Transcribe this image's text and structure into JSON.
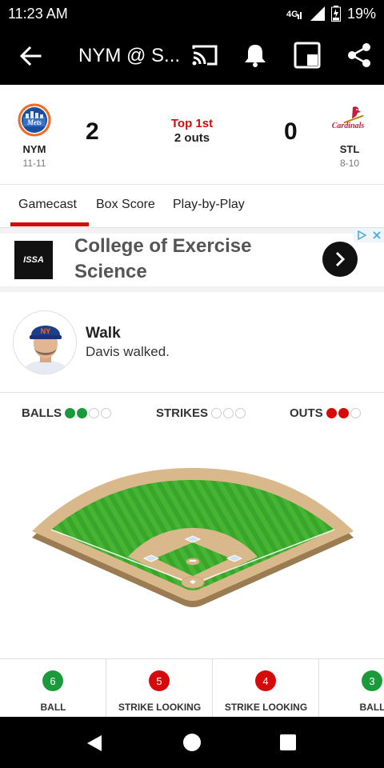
{
  "status_bar": {
    "time": "11:23 AM",
    "battery": "19%"
  },
  "app_bar": {
    "title": "NYM @ S..."
  },
  "game": {
    "away": {
      "abbr": "NYM",
      "record": "11-11",
      "score": "2"
    },
    "home": {
      "abbr": "STL",
      "record": "8-10",
      "score": "0"
    },
    "inning": "Top 1st",
    "outs_text": "2 outs"
  },
  "tabs": [
    {
      "label": "Gamecast"
    },
    {
      "label": "Box Score"
    },
    {
      "label": "Play-by-Play"
    }
  ],
  "ad": {
    "logo_text": "ISSA",
    "line1": "College of Exercise",
    "line2": "Science"
  },
  "play": {
    "title": "Walk",
    "description": "Davis walked."
  },
  "count": {
    "balls_label": "BALLS",
    "balls": 2,
    "balls_max": 4,
    "strikes_label": "STRIKES",
    "strikes": 0,
    "strikes_max": 3,
    "outs_label": "OUTS",
    "outs": 2,
    "outs_max": 3
  },
  "pitches": [
    {
      "number": "6",
      "label": "BALL",
      "color": "#1b9a3c"
    },
    {
      "number": "5",
      "label": "STRIKE LOOKING",
      "color": "#d50a0a"
    },
    {
      "number": "4",
      "label": "STRIKE LOOKING",
      "color": "#d50a0a"
    },
    {
      "number": "3",
      "label": "BALL",
      "color": "#1b9a3c"
    }
  ],
  "colors": {
    "accent": "#d50a0a",
    "ball_green": "#1b9a3c"
  }
}
